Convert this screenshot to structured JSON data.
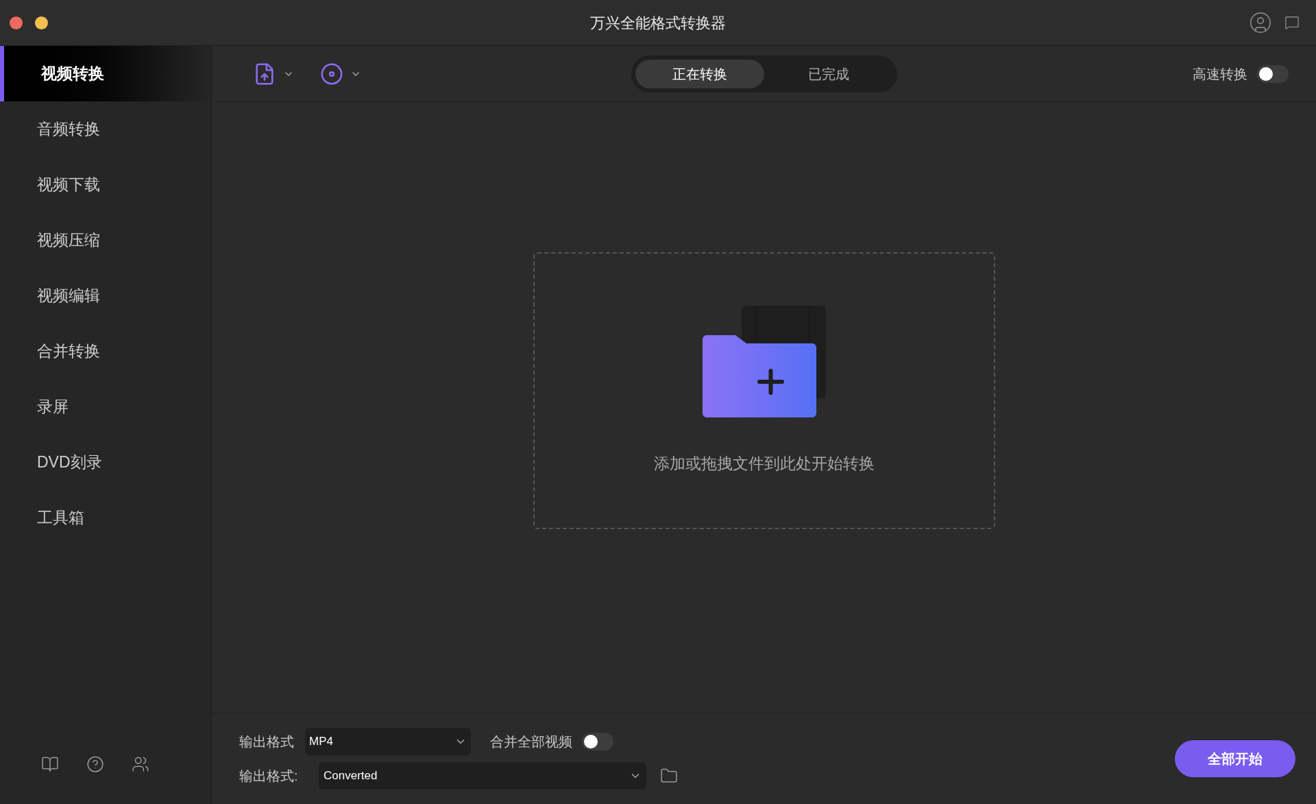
{
  "window": {
    "title": "万兴全能格式转换器",
    "traffic_lights": [
      {
        "color": "#ed6a5e"
      },
      {
        "color": "#f5bf4f"
      }
    ]
  },
  "sidebar": {
    "items": [
      {
        "label": "视频转换",
        "selected": true
      },
      {
        "label": "音频转换",
        "selected": false
      },
      {
        "label": "视频下载",
        "selected": false
      },
      {
        "label": "视频压缩",
        "selected": false
      },
      {
        "label": "视频编辑",
        "selected": false
      },
      {
        "label": "合并转换",
        "selected": false
      },
      {
        "label": "录屏",
        "selected": false
      },
      {
        "label": "DVD刻录",
        "selected": false
      },
      {
        "label": "工具箱",
        "selected": false
      }
    ]
  },
  "toolbar": {
    "tabs": [
      {
        "label": "正在转换",
        "selected": true
      },
      {
        "label": "已完成",
        "selected": false
      }
    ],
    "high_speed": {
      "label": "高速转换",
      "on": false
    }
  },
  "drop_zone": {
    "text": "添加或拖拽文件到此处开始转换"
  },
  "bottom": {
    "format_label": "输出格式",
    "format_value": "MP4",
    "merge": {
      "label": "合并全部视频",
      "on": false
    },
    "output_label": "输出格式:",
    "output_value": "Converted",
    "start_button": "全部开始"
  }
}
